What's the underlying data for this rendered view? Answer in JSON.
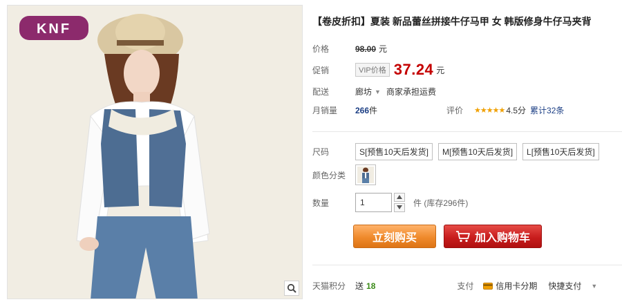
{
  "brand": {
    "logo_text": "KNF"
  },
  "product": {
    "title": "【卷皮折扣】夏装 新品蕾丝拼接牛仔马甲 女 韩版修身牛仔马夹背"
  },
  "price": {
    "label": "价格",
    "original_value": "98.00",
    "unit": "元"
  },
  "promo": {
    "label": "促销",
    "tag": "VIP价格",
    "value": "37.24",
    "unit": "元"
  },
  "shipping": {
    "label": "配送",
    "location": "廊坊",
    "note": "商家承担运费"
  },
  "monthly_sales": {
    "label": "月销量",
    "count": "266",
    "unit": "件",
    "rating_label": "评价",
    "stars": "★★★★★",
    "score": "4.5分",
    "reviews": "累计32条"
  },
  "sizes": {
    "label": "尺码",
    "options": [
      "S[预售10天后发货]",
      "M[预售10天后发货]",
      "L[预售10天后发货]"
    ]
  },
  "colors": {
    "label": "颜色分类"
  },
  "quantity": {
    "label": "数量",
    "value": "1",
    "stock": "件 (库存296件)"
  },
  "actions": {
    "buy_now": "立刻购买",
    "add_to_cart": "加入购物车"
  },
  "points": {
    "label": "天猫积分",
    "prefix": "送",
    "value": "18"
  },
  "payment": {
    "label": "支付",
    "credit": "信用卡分期",
    "express": "快捷支付"
  }
}
